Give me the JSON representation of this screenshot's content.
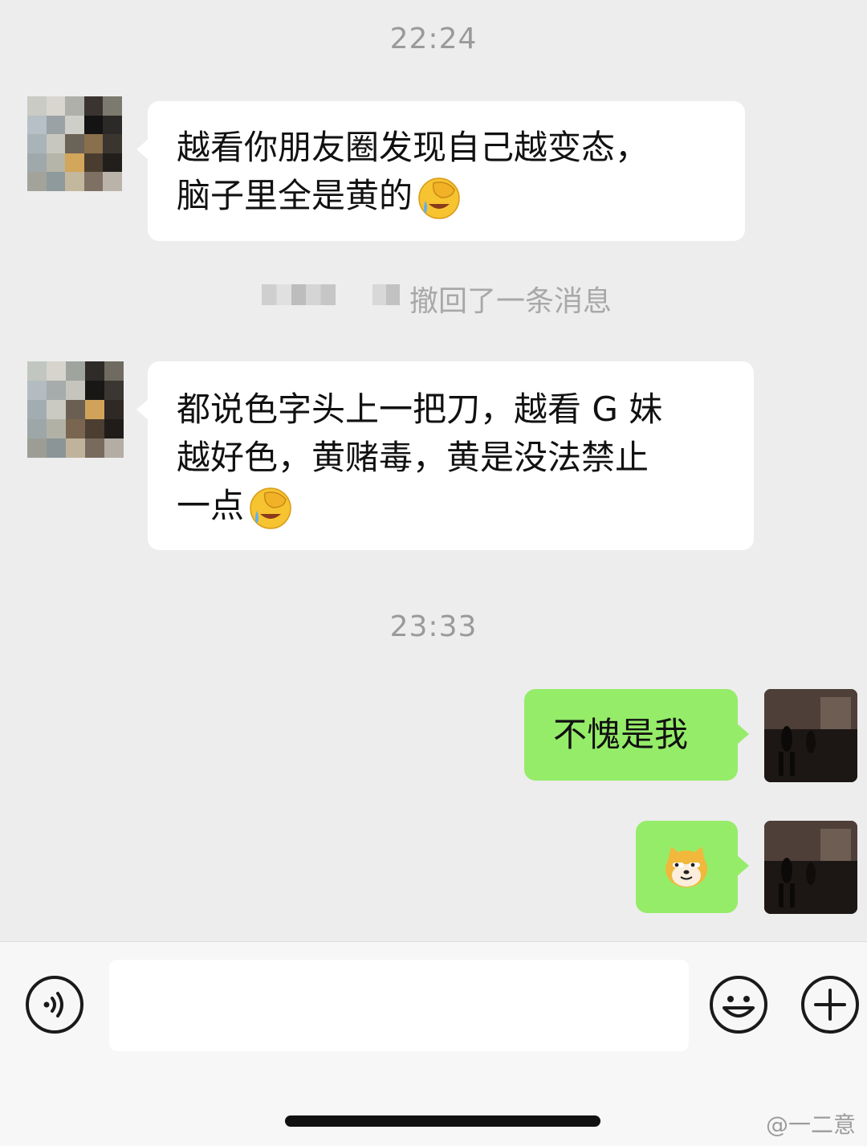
{
  "messages": {
    "time1": "22:24",
    "msg1_line1": "越看你朋友圈发现自己越变态，",
    "msg1_line2": "脑子里全是黄的",
    "recall_text": "撤回了一条消息",
    "msg2_line1": "都说色字头上一把刀，越看 G 妹",
    "msg2_line2": "越好色，黄赌毒，黄是没法禁止",
    "msg2_line3": "一点",
    "time2": "23:33",
    "msg3": "不愧是我"
  },
  "emojis": {
    "facepalm": "face-palm-tears-emoji",
    "doge": "doge-emoji"
  },
  "input": {
    "voice_icon": "voice-icon",
    "emoji_icon": "smiley-icon",
    "plus_icon": "plus-icon",
    "value": ""
  },
  "watermark": "@一二意",
  "colors": {
    "chat_bg": "#ededed",
    "bubble_incoming": "#ffffff",
    "bubble_outgoing": "#95ec69",
    "timestamp": "#9a9a9a"
  }
}
